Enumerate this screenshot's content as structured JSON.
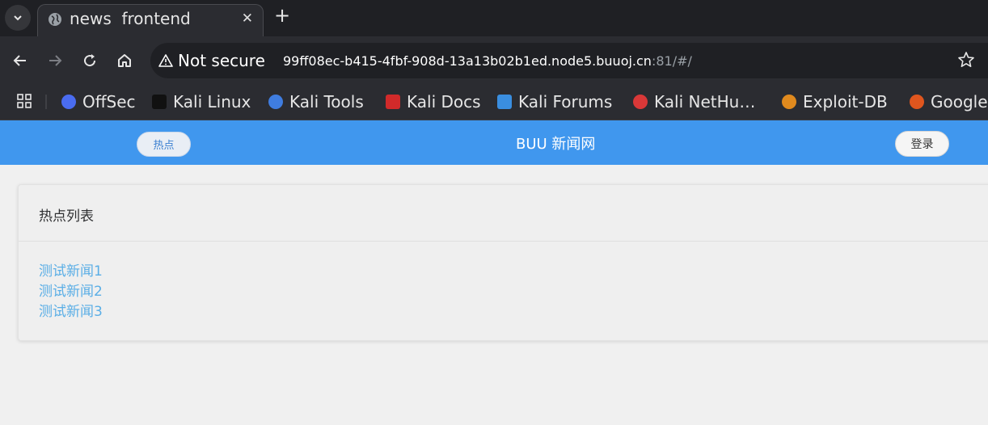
{
  "browser": {
    "tab": {
      "title": "news  frontend",
      "favicon": "globe-icon"
    },
    "omnibox": {
      "security_label": "Not secure",
      "url_host": "99ff08ec-b415-4fbf-908d-13a13b02b1ed.node5.buuoj.cn",
      "url_rest": ":81/#/"
    },
    "bookmarks": [
      {
        "label": "OffSec",
        "color": "#4a6cf0"
      },
      {
        "label": "Kali Linux",
        "color": "#222222"
      },
      {
        "label": "Kali Tools",
        "color": "#3f7de0"
      },
      {
        "label": "Kali Docs",
        "color": "#d12a2a"
      },
      {
        "label": "Kali Forums",
        "color": "#3a8ee0"
      },
      {
        "label": "Kali NetHu…",
        "color": "#d93838"
      },
      {
        "label": "Exploit-DB",
        "color": "#e08a1e"
      },
      {
        "label": "Google",
        "color": "#e0561e"
      }
    ]
  },
  "navbar": {
    "hot_button": "热点",
    "brand": "BUU 新闻网",
    "login_button": "登录",
    "bg_color": "#4097ee"
  },
  "hot_list": {
    "title": "热点列表",
    "items": [
      "测试新闻1",
      "测试新闻2",
      "测试新闻3"
    ]
  }
}
